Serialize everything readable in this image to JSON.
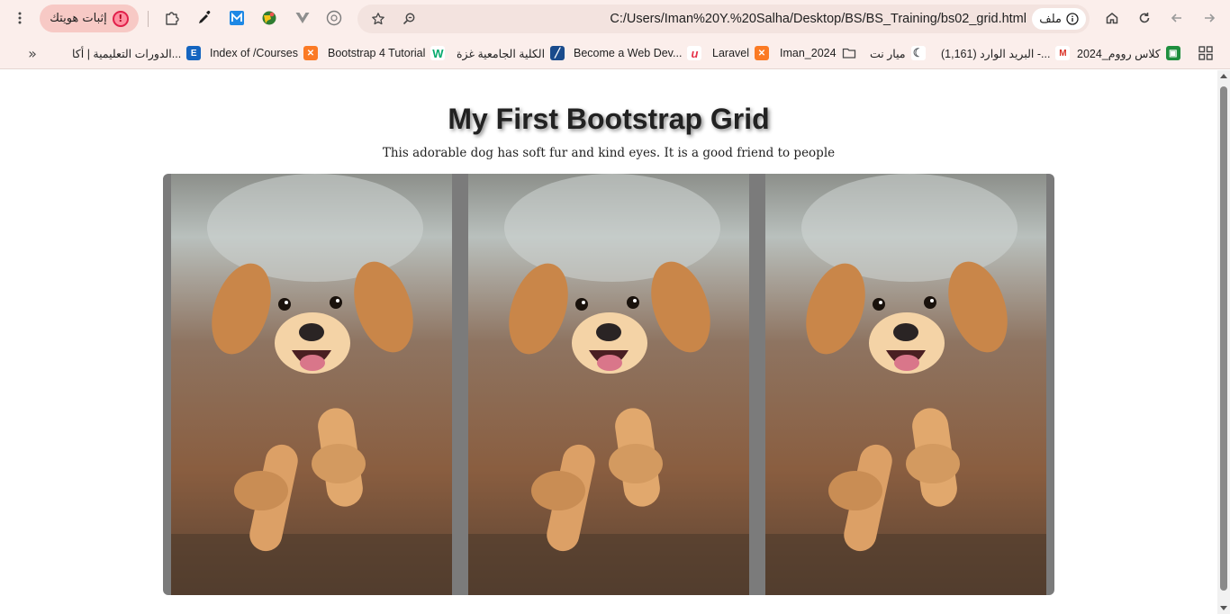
{
  "browser": {
    "url": "C:/Users/Iman%20Y.%20Salha/Desktop/BS/BS_Training/bs02_grid.html",
    "site_chip_label": "ملف",
    "verify_button_label": "إثبات هويتك",
    "verify_badge": "!",
    "icons": [
      "forward-icon",
      "back-icon",
      "reload-icon",
      "home-icon",
      "info-icon",
      "star-icon",
      "zoom-icon",
      "extensions-icon",
      "menu-icon"
    ]
  },
  "bookmarks": [
    {
      "label": "كلاس رووم_2024",
      "icon": "classroom-icon",
      "color": "#1e8e3e"
    },
    {
      "label": "البريد الوارد (1,161) -...",
      "icon": "gmail-icon",
      "color": "#d93025"
    },
    {
      "label": "ميار نت",
      "icon": "moon-icon",
      "color": "#5f6368"
    },
    {
      "label": "Iman_2024",
      "icon": "folder-icon",
      "color": "#474747"
    },
    {
      "label": "Laravel",
      "icon": "xampp-icon",
      "color": "#fb7a24"
    },
    {
      "label": "Become a Web Dev...",
      "icon": "udemy-icon",
      "color": "#a435f0"
    },
    {
      "label": "الكلية الجامعية غزة",
      "icon": "ucas-icon",
      "color": "#1a4b8c"
    },
    {
      "label": "Bootstrap 4 Tutorial",
      "icon": "w3-icon",
      "color": "#04aa6d"
    },
    {
      "label": "Index of /Courses",
      "icon": "xampp-icon",
      "color": "#fb7a24"
    },
    {
      "label": "الدورات التعليمية | أكا...",
      "icon": "e-icon",
      "color": "#1565c0"
    }
  ],
  "page": {
    "title": "My First Bootstrap Grid",
    "subtitle": "This adorable dog has soft fur and kind eyes. It is a good friend to people",
    "images": [
      {
        "alt": "puppy running"
      },
      {
        "alt": "puppy running"
      },
      {
        "alt": "puppy running"
      }
    ]
  },
  "colors": {
    "chrome_bg": "#fbeeeb",
    "omnibox_bg": "#f3e3df",
    "verify_bg": "#f7c9c5",
    "grid_bg": "#7b7b7b"
  }
}
